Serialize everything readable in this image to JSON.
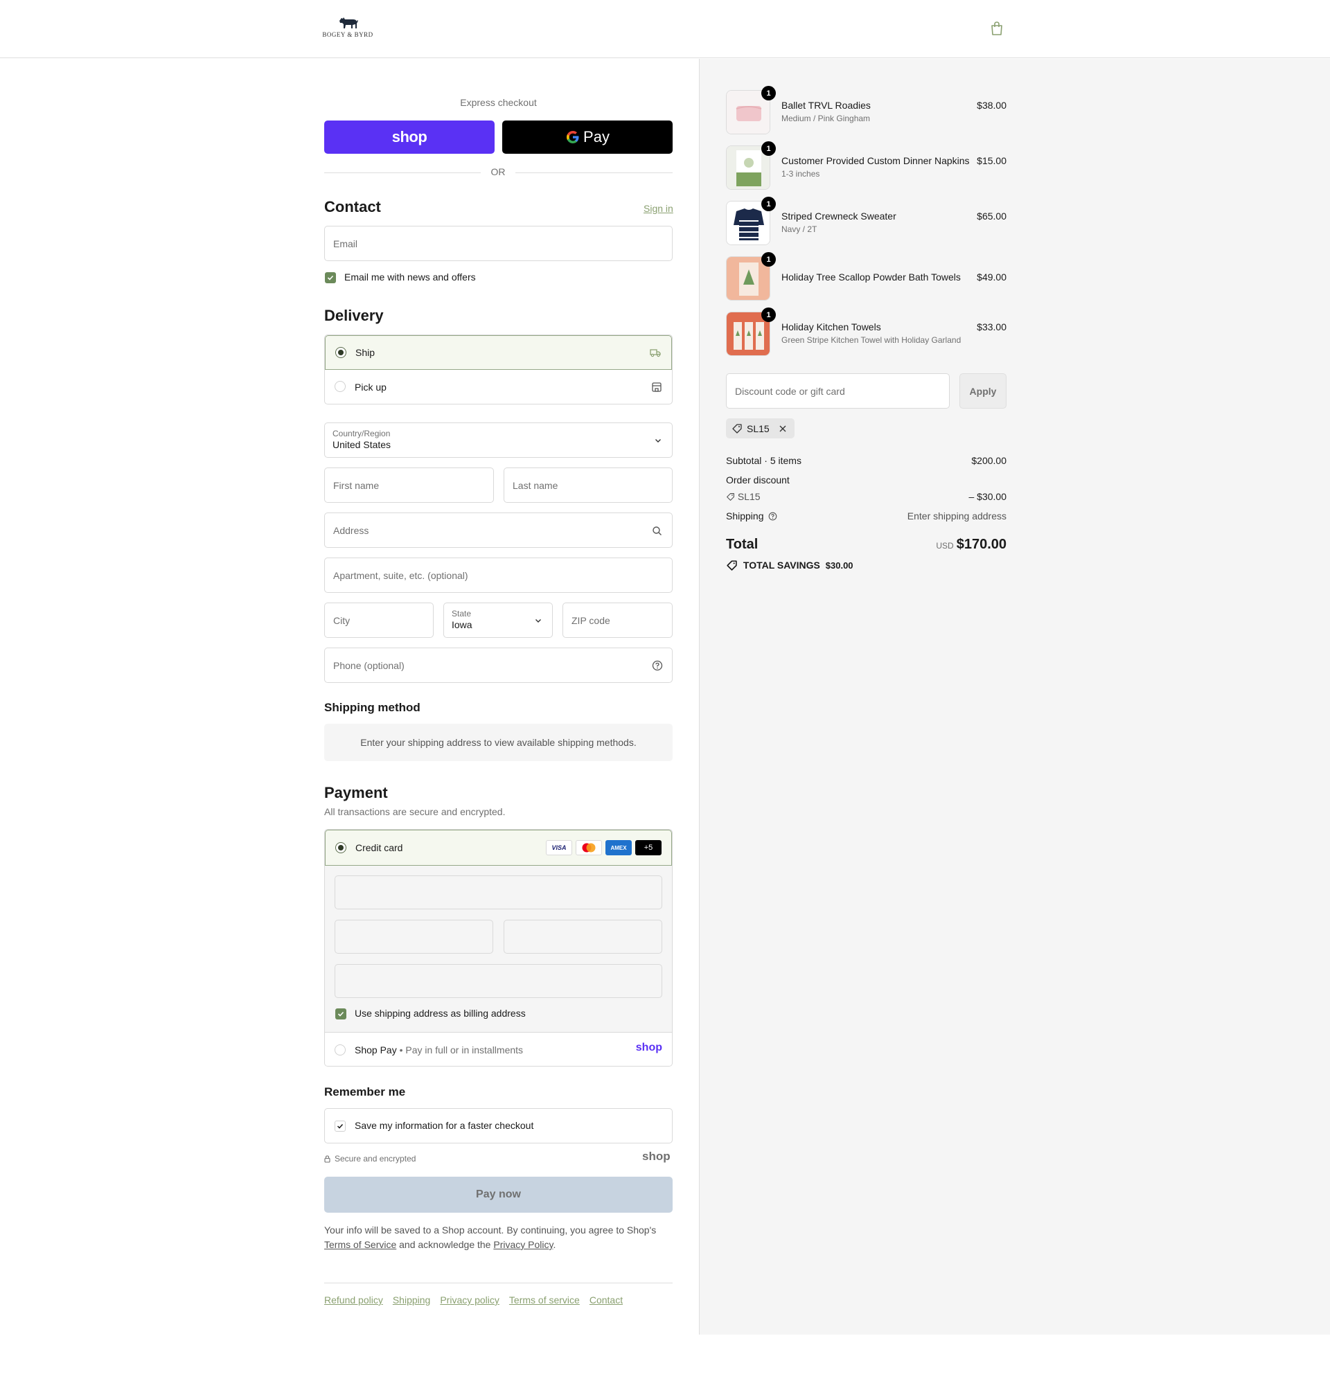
{
  "header": {
    "brand": "BOGEY & BYRD"
  },
  "express": {
    "title": "Express checkout",
    "shop_label": "shop",
    "gpay_label": "Pay",
    "or_label": "OR"
  },
  "contact": {
    "title": "Contact",
    "signin": "Sign in",
    "email_placeholder": "Email",
    "news_label": "Email me with news and offers",
    "news_checked": true
  },
  "delivery": {
    "title": "Delivery",
    "options": [
      {
        "label": "Ship",
        "selected": true
      },
      {
        "label": "Pick up",
        "selected": false
      }
    ],
    "country_label": "Country/Region",
    "country_value": "United States",
    "first_name": "First name",
    "last_name": "Last name",
    "address": "Address",
    "apartment": "Apartment, suite, etc. (optional)",
    "city": "City",
    "state_label": "State",
    "state_value": "Iowa",
    "zip": "ZIP code",
    "phone": "Phone (optional)"
  },
  "shipping_method": {
    "title": "Shipping method",
    "info": "Enter your shipping address to view available shipping methods."
  },
  "payment": {
    "title": "Payment",
    "subtitle": "All transactions are secure and encrypted.",
    "credit_card": "Credit card",
    "cards": [
      "VISA",
      "MC",
      "AMEX",
      "+5"
    ],
    "billing_label": "Use shipping address as billing address",
    "shop_pay": "Shop Pay",
    "shop_pay_sub": "Pay in full or in installments",
    "shop_pay_logo": "shop"
  },
  "remember": {
    "title": "Remember me",
    "save_label": "Save my information for a faster checkout",
    "secure": "Secure and encrypted",
    "shop_logo": "shop"
  },
  "paynow": "Pay now",
  "legal": {
    "line1": "Your info will be saved to a Shop account. By continuing, you agree to Shop's",
    "tos": "Terms of Service",
    "mid": "and acknowledge the",
    "privacy": "Privacy Policy",
    "end": "."
  },
  "footer": [
    "Refund policy",
    "Shipping",
    "Privacy policy",
    "Terms of service",
    "Contact"
  ],
  "cart": {
    "items": [
      {
        "name": "Ballet TRVL Roadies",
        "variant": "Medium / Pink Gingham",
        "price": "$38.00",
        "qty": "1"
      },
      {
        "name": "Customer Provided Custom Dinner Napkins",
        "variant": "1-3 inches",
        "price": "$15.00",
        "qty": "1"
      },
      {
        "name": "Striped Crewneck Sweater",
        "variant": "Navy / 2T",
        "price": "$65.00",
        "qty": "1"
      },
      {
        "name": "Holiday Tree Scallop Powder Bath Towels",
        "variant": "",
        "price": "$49.00",
        "qty": "1"
      },
      {
        "name": "Holiday Kitchen Towels",
        "variant": "Green Stripe Kitchen Towel with Holiday Garland",
        "price": "$33.00",
        "qty": "1"
      }
    ],
    "discount_placeholder": "Discount code or gift card",
    "apply": "Apply",
    "code": "SL15",
    "subtotal_label": "Subtotal · 5 items",
    "subtotal": "$200.00",
    "order_discount": "Order discount",
    "discount_code": "SL15",
    "discount_value": "– $30.00",
    "shipping_label": "Shipping",
    "shipping_value": "Enter shipping address",
    "total_label": "Total",
    "currency": "USD",
    "total": "$170.00",
    "savings_label": "TOTAL SAVINGS",
    "savings": "$30.00"
  }
}
